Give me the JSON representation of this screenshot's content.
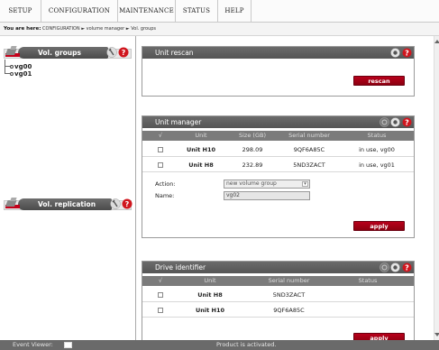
{
  "menu": {
    "items": [
      {
        "label": "SETUP"
      },
      {
        "label": "CONFIGURATION"
      },
      {
        "label": "MAINTENANCE"
      },
      {
        "label": "STATUS"
      },
      {
        "label": "HELP"
      }
    ]
  },
  "breadcrumb": {
    "prefix": "You are here:",
    "path": "CONFIGURATION ► volume manager ► Vol. groups"
  },
  "sidebar": {
    "vol_groups_title": "Vol. groups",
    "tree": [
      "vg00",
      "vg01"
    ],
    "vol_replication_title": "Vol. replication"
  },
  "unit_rescan": {
    "title": "Unit rescan",
    "button": "rescan"
  },
  "unit_manager": {
    "title": "Unit manager",
    "columns": [
      "√",
      "Unit",
      "Size (GB)",
      "Serial number",
      "Status"
    ],
    "rows": [
      {
        "unit": "Unit H10",
        "size": "298.09",
        "serial": "9QF6A85C",
        "status": "in use, vg00"
      },
      {
        "unit": "Unit H8",
        "size": "232.89",
        "serial": "5ND3ZACT",
        "status": "in use, vg01"
      }
    ],
    "action_label": "Action:",
    "action_value": "new volume group",
    "name_label": "Name:",
    "name_value": "vg02",
    "apply": "apply"
  },
  "drive_identifier": {
    "title": "Drive identifier",
    "columns": [
      "√",
      "Unit",
      "Serial number",
      "Status"
    ],
    "rows": [
      {
        "unit": "Unit H8",
        "serial": "5ND3ZACT"
      },
      {
        "unit": "Unit H10",
        "serial": "9QF6A85C"
      }
    ],
    "apply": "apply"
  },
  "status_bar": {
    "event_viewer": "Event Viewer:",
    "message": "Product is activated."
  },
  "colors": {
    "header_gray": "#5f5f5f",
    "button_red": "#a10015",
    "help_red": "#d0161e"
  }
}
